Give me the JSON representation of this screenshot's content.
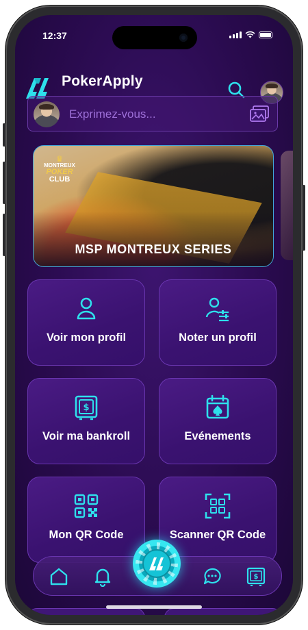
{
  "status_bar": {
    "time": "12:37"
  },
  "header": {
    "brand": "PokerApply"
  },
  "composer": {
    "placeholder": "Exprimez-vous..."
  },
  "banner": {
    "title": "MSP MONTREUX SERIES",
    "club_logo": {
      "line1": "MONTREUX",
      "line2": "POKER",
      "line3": "CLUB"
    }
  },
  "tiles": [
    {
      "label": "Voir mon profil",
      "icon": "user-icon"
    },
    {
      "label": "Noter un profil",
      "icon": "user-rate-icon"
    },
    {
      "label": "Voir ma bankroll",
      "icon": "safe-icon"
    },
    {
      "label": "Evénements",
      "icon": "calendar-spade-icon"
    },
    {
      "label": "Mon QR Code",
      "icon": "qr-code-icon"
    },
    {
      "label": "Scanner QR Code",
      "icon": "qr-scan-icon"
    }
  ],
  "nav": {
    "items": [
      "home-icon",
      "bell-icon",
      "poker-chip-icon",
      "chat-icon",
      "safe-icon"
    ]
  },
  "colors": {
    "accent": "#22d8e8",
    "background": "#2a0b4f",
    "tile": "#3e1475"
  }
}
